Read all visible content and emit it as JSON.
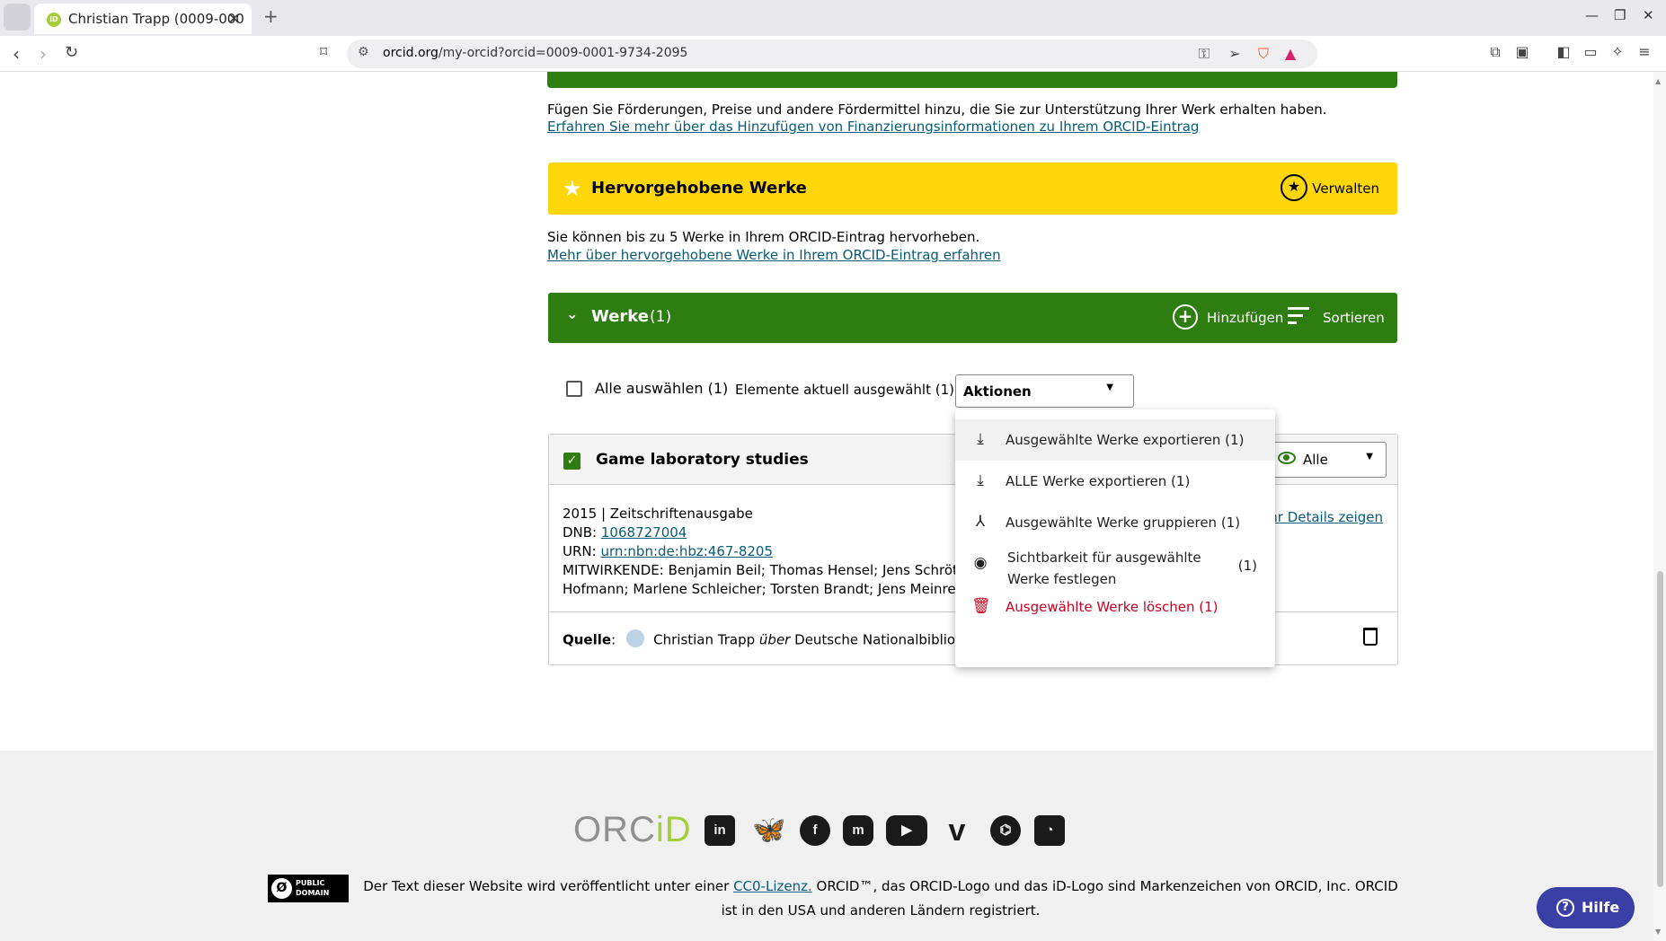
{
  "browser": {
    "tab_title": "Christian Trapp (0009-000",
    "new_tab": "+",
    "url_host": "orcid.org",
    "url_path": "/my-orcid?orcid=0009-0001-9734-2095"
  },
  "funding": {
    "description": "Fügen Sie Förderungen, Preise und andere Fördermittel hinzu, die Sie zur Unterstützung Ihrer Werk erhalten haben.",
    "link": "Erfahren Sie mehr über das Hinzufügen von Finanzierungsinformationen zu Ihrem ORCID-Eintrag"
  },
  "featured": {
    "title": "Hervorgehobene Werke",
    "manage": "Verwalten",
    "description": "Sie können bis zu 5 Werke in Ihrem ORCID-Eintrag hervorheben.",
    "link": "Mehr über hervorgehobene Werke in Ihrem ORCID-Eintrag erfahren"
  },
  "works": {
    "title": "Werke",
    "count": "(1)",
    "add": "Hinzufügen",
    "sort": "Sortieren",
    "select_all": "Alle auswählen (1)",
    "selected_info": "Elemente aktuell ausgewählt (1)",
    "actions_label": "Aktionen"
  },
  "actions_menu": {
    "items": [
      {
        "label": "Ausgewählte Werke exportieren (1)",
        "icon": "download-icon"
      },
      {
        "label": "ALLE Werke exportieren (1)",
        "icon": "download-icon"
      },
      {
        "label": "Ausgewählte Werke gruppieren (1)",
        "icon": "merge-icon"
      },
      {
        "label": "Sichtbarkeit für ausgewählte Werke festlegen",
        "count": "(1)",
        "icon": "eye-icon"
      },
      {
        "label": "Ausgewählte Werke löschen (1)",
        "icon": "trash-icon"
      }
    ]
  },
  "work_item": {
    "title": "Game laboratory studies",
    "visibility": "Alle",
    "year_type": "2015 | Zeitschriftenausgabe",
    "dnb_label": "DNB: ",
    "dnb_value": "1068727004",
    "urn_label": "URN: ",
    "urn_value": "urn:nbn:de:hbz:467-8205",
    "contributors_line1": "MITWIRKENDE: Benjamin Beil; Thomas Hensel; Jens Schröter; Ph",
    "contributors_line2": "Hofmann; Marlene Schleicher; Torsten Brandt; Jens Meinrenken",
    "more_details": "ehr Details zeigen",
    "source_label": "Quelle",
    "source_colon": ":",
    "source_name": "Christian Trapp",
    "source_via": "über",
    "source_org": "Deutsche Nationalbibliothek ("
  },
  "footer": {
    "logo_orc": "ORC",
    "logo_id": "iD",
    "social": [
      "linkedin-icon",
      "bluesky-icon",
      "facebook-icon",
      "mastodon-icon",
      "youtube-icon",
      "vimeo-icon",
      "github-icon",
      "rss-icon"
    ],
    "pd_line1": "PUBLIC",
    "pd_line2": "DOMAIN",
    "text_before": "Der Text dieser Website wird veröffentlicht unter einer ",
    "text_link": "CC0-Lizenz.",
    "text_after": " ORCID™, das ORCID-Logo und das iD-Logo sind Markenzeichen von ORCID, Inc. ORCID ist in den USA und anderen Ländern registriert."
  },
  "help": {
    "label": "Hilfe"
  },
  "colors": {
    "green": "#2e7d10",
    "yellow": "#ffd60a",
    "link": "#085c77",
    "danger": "#c9001f",
    "help": "#3a3fa6"
  }
}
